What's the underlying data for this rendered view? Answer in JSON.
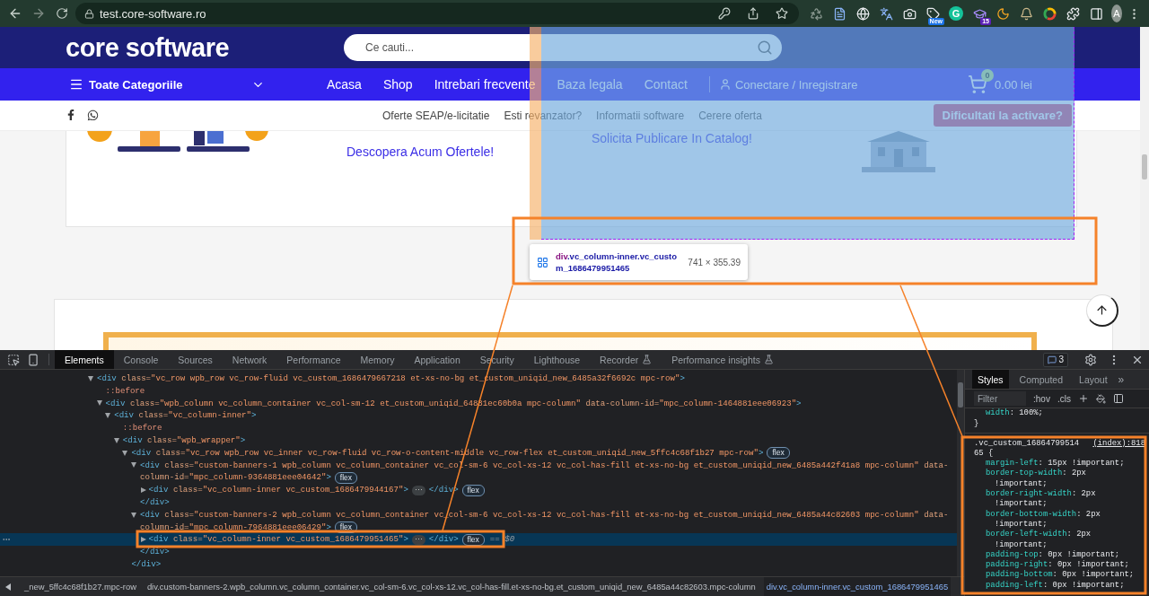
{
  "browser": {
    "url": "test.core-software.ro",
    "avatar": "A",
    "extensions": [
      {
        "kind": "recycle"
      },
      {
        "kind": "doc"
      },
      {
        "kind": "globe"
      },
      {
        "kind": "translate"
      },
      {
        "kind": "camera"
      },
      {
        "kind": "tag",
        "badge": "New"
      },
      {
        "kind": "letter",
        "label": "G"
      },
      {
        "kind": "cap",
        "badge": "15"
      },
      {
        "kind": "moon"
      },
      {
        "kind": "bell"
      },
      {
        "kind": "ring"
      },
      {
        "kind": "puzzle"
      },
      {
        "kind": "panel"
      }
    ]
  },
  "site": {
    "logo": "core software",
    "search": {
      "placeholder": "Ce cauti..."
    },
    "nav": {
      "categories": "Toate Categoriile",
      "links": [
        "Acasa",
        "Shop",
        "Intrebari frecvente",
        "Baza legala",
        "Contact"
      ],
      "account": "Conectare / Inregistrare",
      "cart": {
        "count": "0",
        "total": "0.00 lei"
      }
    },
    "topbar": {
      "social": [
        {
          "kind": "facebook"
        },
        {
          "kind": "whatsapp"
        }
      ],
      "links": [
        "Oferte SEAP/e-licitatie",
        "Esti revanzator?",
        "Informatii software",
        "Cerere oferta"
      ],
      "cta": "Dificultati la activare?"
    },
    "banners": [
      {
        "text": "Descopera Acum Ofertele!"
      },
      {
        "text": "Solicita Publicare In Catalog!"
      }
    ]
  },
  "inspector": {
    "tag": "div",
    "selector": ".vc_column-inner.vc_custom_1686479951465",
    "size": "741 × 355.39"
  },
  "devtools": {
    "tabs": [
      {
        "label": "Elements",
        "selected": true,
        "experimental": false
      },
      {
        "label": "Console",
        "selected": false,
        "experimental": false
      },
      {
        "label": "Sources",
        "selected": false,
        "experimental": false
      },
      {
        "label": "Network",
        "selected": false,
        "experimental": false
      },
      {
        "label": "Performance",
        "selected": false,
        "experimental": false
      },
      {
        "label": "Memory",
        "selected": false,
        "experimental": false
      },
      {
        "label": "Application",
        "selected": false,
        "experimental": false
      },
      {
        "label": "Security",
        "selected": false,
        "experimental": false
      },
      {
        "label": "Lighthouse",
        "selected": false,
        "experimental": false
      },
      {
        "label": "Recorder",
        "selected": false,
        "experimental": true
      },
      {
        "label": "Performance insights",
        "selected": false,
        "experimental": true
      }
    ],
    "issues": "3",
    "tree": [
      {
        "kind": "element",
        "selected": false,
        "expanded": true,
        "lines": [
          [
            {
              "kind": "tag",
              "text": "<div "
            },
            {
              "kind": "attr",
              "text": "class="
            },
            {
              "kind": "value",
              "text": "\"vc_row wpb_row vc_row-fluid vc_custom_1686479667218 et-xs-no-bg et_custom_uniqid_new_6485a32f6692c mpc-row\""
            },
            {
              "kind": "tag",
              "text": ">"
            }
          ]
        ],
        "children": [
          {
            "kind": "pseudo",
            "lines": [
              [
                {
                  "kind": "pseudo",
                  "text": "::before"
                }
              ]
            ]
          },
          {
            "kind": "element",
            "selected": false,
            "expanded": true,
            "lines": [
              [
                {
                  "kind": "tag",
                  "text": "<div "
                },
                {
                  "kind": "attr",
                  "text": "class="
                },
                {
                  "kind": "value",
                  "text": "\"wpb_column vc_column_container vc_col-sm-12 et_custom_uniqid_64881ec60b0a mpc-column\""
                },
                {
                  "kind": "attr",
                  "text": " data-column-id="
                },
                {
                  "kind": "value",
                  "text": "\"mpc_column-1464881eee06923\""
                },
                {
                  "kind": "tag",
                  "text": ">"
                }
              ]
            ],
            "children": [
              {
                "kind": "element",
                "selected": false,
                "expanded": true,
                "lines": [
                  [
                    {
                      "kind": "tag",
                      "text": "<div "
                    },
                    {
                      "kind": "attr",
                      "text": "class="
                    },
                    {
                      "kind": "value",
                      "text": "\"vc_column-inner\""
                    },
                    {
                      "kind": "tag",
                      "text": ">"
                    }
                  ]
                ],
                "children": [
                  {
                    "kind": "pseudo",
                    "lines": [
                      [
                        {
                          "kind": "pseudo",
                          "text": "::before"
                        }
                      ]
                    ]
                  },
                  {
                    "kind": "element",
                    "selected": false,
                    "expanded": true,
                    "lines": [
                      [
                        {
                          "kind": "tag",
                          "text": "<div "
                        },
                        {
                          "kind": "attr",
                          "text": "class="
                        },
                        {
                          "kind": "value",
                          "text": "\"wpb_wrapper\""
                        },
                        {
                          "kind": "tag",
                          "text": ">"
                        }
                      ]
                    ],
                    "children": [
                      {
                        "kind": "element",
                        "selected": false,
                        "expanded": true,
                        "closing": "</div>",
                        "lines": [
                          [
                            {
                              "kind": "tag",
                              "text": "<div "
                            },
                            {
                              "kind": "attr",
                              "text": "class="
                            },
                            {
                              "kind": "value",
                              "text": "\"vc_row wpb_row vc_inner vc_row-fluid vc_row-o-content-middle vc_row-flex et_custom_uniqid_new_5ffc4c68f1b27 mpc-row\""
                            },
                            {
                              "kind": "tag",
                              "text": ">"
                            },
                            {
                              "kind": "badge",
                              "text": "flex"
                            }
                          ]
                        ],
                        "children": [
                          {
                            "kind": "element",
                            "selected": false,
                            "expanded": true,
                            "closing": "</div>",
                            "lines": [
                              [
                                {
                                  "kind": "tag",
                                  "text": "<div "
                                },
                                {
                                  "kind": "attr",
                                  "text": "class="
                                },
                                {
                                  "kind": "value",
                                  "text": "\"custom-banners-1 wpb_column vc_column_container vc_col-sm-6 vc_col-xs-12 vc_col-has-fill et-xs-no-bg et_custom_uniqid_new_6485a442f41a8 mpc-column\""
                                },
                                {
                                  "kind": "attr",
                                  "text": " data-"
                                }
                              ],
                              [
                                {
                                  "kind": "attr",
                                  "text": "column-id="
                                },
                                {
                                  "kind": "value",
                                  "text": "\"mpc_column-9364881eee04642\""
                                },
                                {
                                  "kind": "tag",
                                  "text": ">"
                                },
                                {
                                  "kind": "badge",
                                  "text": "flex"
                                }
                              ]
                            ],
                            "children": [
                              {
                                "kind": "element",
                                "selected": false,
                                "expanded": false,
                                "lines": [
                                  [
                                    {
                                      "kind": "tag",
                                      "text": "<div "
                                    },
                                    {
                                      "kind": "attr",
                                      "text": "class="
                                    },
                                    {
                                      "kind": "value",
                                      "text": "\"vc_column-inner vc_custom_1686479944167\""
                                    },
                                    {
                                      "kind": "tag",
                                      "text": ">"
                                    },
                                    {
                                      "kind": "ellipsis",
                                      "text": "⋯"
                                    },
                                    {
                                      "kind": "tag",
                                      "text": "</div>"
                                    },
                                    {
                                      "kind": "badge",
                                      "text": "flex"
                                    }
                                  ]
                                ]
                              }
                            ]
                          },
                          {
                            "kind": "element",
                            "selected": false,
                            "expanded": true,
                            "closing": "</div>",
                            "lines": [
                              [
                                {
                                  "kind": "tag",
                                  "text": "<div "
                                },
                                {
                                  "kind": "attr",
                                  "text": "class="
                                },
                                {
                                  "kind": "value",
                                  "text": "\"custom-banners-2 wpb_column vc_column_container vc_col-sm-6 vc_col-xs-12 vc_col-has-fill et-xs-no-bg et_custom_uniqid_new_6485a44c82603 mpc-column\""
                                },
                                {
                                  "kind": "attr",
                                  "text": " data-"
                                }
                              ],
                              [
                                {
                                  "kind": "attr",
                                  "text": "column-id="
                                },
                                {
                                  "kind": "value",
                                  "text": "\"mpc_column-7964881eee06429\""
                                },
                                {
                                  "kind": "tag",
                                  "text": ">"
                                },
                                {
                                  "kind": "badge",
                                  "text": "flex"
                                }
                              ]
                            ],
                            "children": [
                              {
                                "kind": "element",
                                "selected": true,
                                "expanded": false,
                                "lines": [
                                  [
                                    {
                                      "kind": "tag",
                                      "text": "<div "
                                    },
                                    {
                                      "kind": "attr",
                                      "text": "class="
                                    },
                                    {
                                      "kind": "value",
                                      "text": "\"vc_column-inner vc_custom_1686479951465\""
                                    },
                                    {
                                      "kind": "tag",
                                      "text": ">"
                                    },
                                    {
                                      "kind": "ellipsis",
                                      "text": "⋯"
                                    },
                                    {
                                      "kind": "tag",
                                      "text": "</div>"
                                    },
                                    {
                                      "kind": "badge",
                                      "text": "flex"
                                    },
                                    {
                                      "kind": "marker",
                                      "text": "== $0"
                                    }
                                  ]
                                ]
                              }
                            ]
                          }
                        ]
                      }
                    ]
                  }
                ]
              }
            ]
          }
        ]
      }
    ],
    "breadcrumbs": [
      {
        "text": "_new_5ffc4c68f1b27.mpc-row",
        "selected": false
      },
      {
        "text": "div.custom-banners-2.wpb_column.vc_column_container.vc_col-sm-6.vc_col-xs-12.vc_col-has-fill.et-xs-no-bg.et_custom_uniqid_new_6485a44c82603.mpc-column",
        "selected": false
      },
      {
        "text": "div.vc_column-inner.vc_custom_1686479951465",
        "selected": true
      }
    ],
    "styles": {
      "separator": ": ",
      "tabs": [
        {
          "label": "Styles",
          "selected": true
        },
        {
          "label": "Computed",
          "selected": false
        },
        {
          "label": "Layout",
          "selected": false
        }
      ],
      "more": "»",
      "filter": {
        "placeholder": "Filter"
      },
      "toggles": [
        ":hov",
        ".cls"
      ],
      "previous_rule": {
        "declarations": [
          {
            "property": "width",
            "value": "100%;"
          }
        ],
        "close": "}"
      },
      "rule": {
        "selector": ".vc_custom_1686479951465 {",
        "source": "(index):818",
        "declarations": [
          {
            "property": "margin-left",
            "value": "15px !important;"
          },
          {
            "property": "border-top-width",
            "value": "2px !important;"
          },
          {
            "property": "border-right-width",
            "value": "2px !important;"
          },
          {
            "property": "border-bottom-width",
            "value": "2px !important;"
          },
          {
            "property": "border-left-width",
            "value": "2px !important;"
          },
          {
            "property": "padding-top",
            "value": "0px !important;"
          },
          {
            "property": "padding-right",
            "value": "0px !important;"
          },
          {
            "property": "padding-bottom",
            "value": "0px !important;"
          },
          {
            "property": "padding-left",
            "value": "0px !important;"
          }
        ]
      }
    }
  }
}
